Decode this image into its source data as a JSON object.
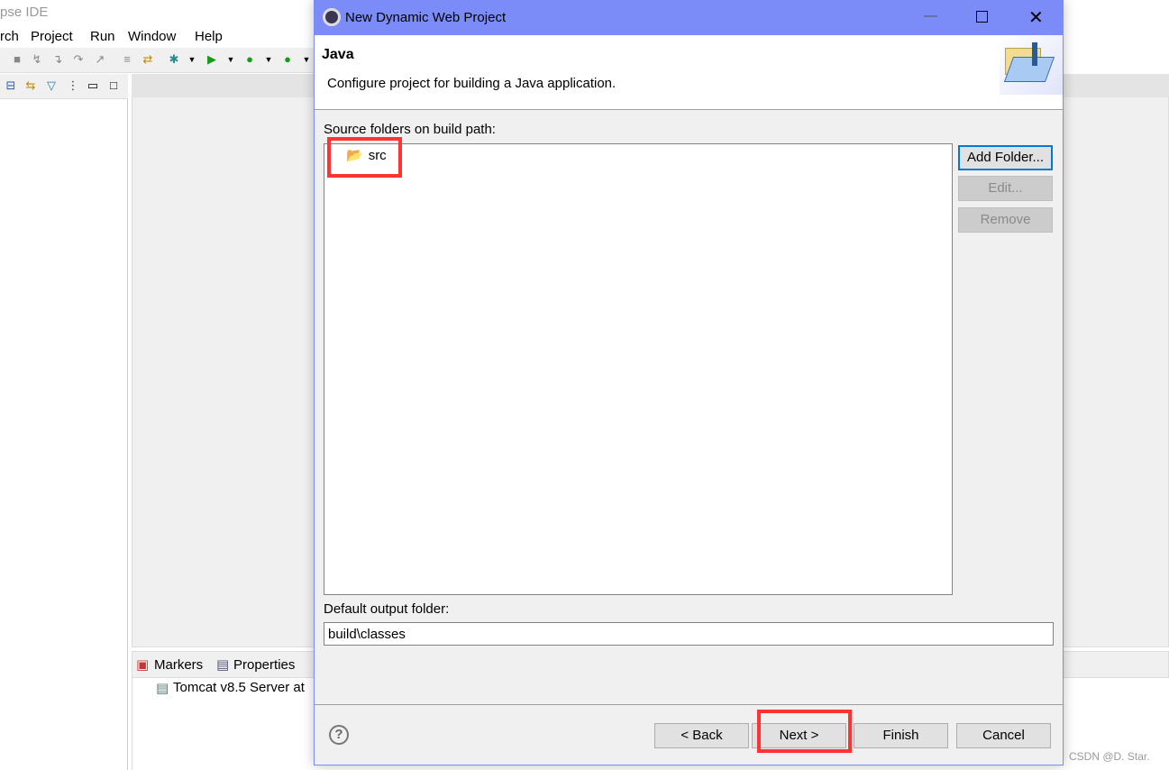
{
  "ide": {
    "title": "pse IDE",
    "menu": [
      "rch",
      "Project",
      "Run",
      "Window",
      "Help"
    ],
    "bottom_tabs": [
      "Markers",
      "Properties"
    ],
    "server_item": "Tomcat v8.5 Server at"
  },
  "dialog": {
    "title": "New Dynamic Web Project",
    "header_title": "Java",
    "header_desc": "Configure project for building a Java application.",
    "source_label": "Source folders on build path:",
    "source_folders": [
      "src"
    ],
    "add_folder": "Add Folder...",
    "edit": "Edit...",
    "remove": "Remove",
    "output_label": "Default output folder:",
    "output_value": "build\\classes",
    "back": "< Back",
    "next": "Next >",
    "finish": "Finish",
    "cancel": "Cancel"
  },
  "watermark": "CSDN @D. Star.",
  "colors": {
    "titlebar": "#7b8cf8",
    "highlight": "#ff3333",
    "focus": "#0078d7"
  }
}
